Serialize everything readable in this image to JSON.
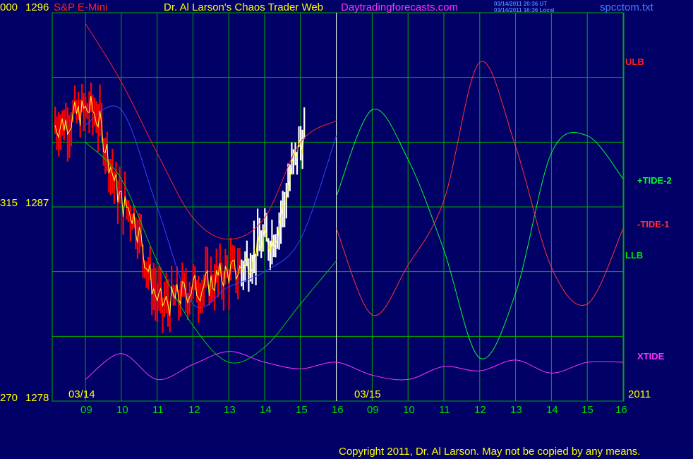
{
  "header": {
    "left_code": "000",
    "left_price": "1296",
    "symbol": "S&P E-Mini",
    "title": "Dr. Al Larson's Chaos Trader Web",
    "site": "Daytradingforecasts.com",
    "time_ut": "03/14/2011 20:36 UT",
    "time_local": "03/14/2011 16:36 Local",
    "file": "spcctom.txt"
  },
  "y_axis": {
    "mid_code": "315",
    "mid_price": "1287",
    "bottom_code": "270",
    "bottom_price": "1278"
  },
  "x_axis": {
    "hours": [
      "09",
      "10",
      "11",
      "12",
      "13",
      "14",
      "15",
      "16",
      "09",
      "10",
      "11",
      "12",
      "13",
      "14",
      "15",
      "16"
    ],
    "date_left": "03/14",
    "date_mid": "03/15",
    "year": "2011"
  },
  "legend": {
    "ulb": "ULB",
    "tide2": "+TIDE-2",
    "tide1": "-TIDE-1",
    "llb": "LLB",
    "xtide": "XTIDE"
  },
  "footer": {
    "copyright": "Copyright 2011, Dr. Al Larson. May not be copied by any means."
  },
  "colors": {
    "background": "#000066",
    "grid": "#00aa00",
    "ulb": "#ff2020",
    "llb": "#00cc00",
    "tide2": "#00ff33",
    "tide1": "#ff3333",
    "xtide": "#ff33ff",
    "price_fast": "#ffff33",
    "price_slow": "#3344ff",
    "bars_history": "#ff0000",
    "bars_today": "#ffffff"
  },
  "chart_data": {
    "type": "line",
    "title": "S&P E-Mini",
    "xlabel": "",
    "ylabel": "",
    "ylim": [
      1278,
      1296
    ],
    "x": [
      "03/14 09:00",
      "03/14 10:00",
      "03/14 11:00",
      "03/14 12:00",
      "03/14 13:00",
      "03/14 14:00",
      "03/14 15:00",
      "03/14 16:00",
      "03/15 09:00",
      "03/15 10:00",
      "03/15 11:00",
      "03/15 12:00",
      "03/15 13:00",
      "03/15 14:00",
      "03/15 15:00",
      "03/15 16:00"
    ],
    "series": [
      {
        "name": "ULB",
        "values": [
          1295.5,
          1292.8,
          1289.5,
          1286.5,
          1285.5,
          1286.5,
          1290.0,
          1291.0,
          null,
          null,
          null,
          null,
          null,
          null,
          null,
          null
        ]
      },
      {
        "name": "LLB",
        "values": [
          1290.0,
          1288.3,
          1284.5,
          1281.5,
          1279.8,
          1280.5,
          1282.5,
          1284.5,
          null,
          null,
          null,
          null,
          null,
          null,
          null,
          null
        ]
      },
      {
        "name": "+TIDE-2",
        "values": [
          null,
          null,
          null,
          null,
          null,
          null,
          null,
          1287.5,
          1291.5,
          1289.2,
          1285.0,
          1280.0,
          1283.0,
          1289.5,
          1290.3,
          1288.3
        ]
      },
      {
        "name": "-TIDE-1",
        "values": [
          null,
          null,
          null,
          null,
          null,
          null,
          null,
          1286.0,
          1282.0,
          1284.3,
          1287.3,
          1293.7,
          1289.8,
          1284.2,
          1282.5,
          1286.0
        ]
      },
      {
        "name": "XTIDE",
        "values": [
          1279.0,
          1280.2,
          1279.0,
          1279.7,
          1280.3,
          1279.8,
          1279.5,
          1279.8,
          1279.2,
          1279.0,
          1279.6,
          1279.4,
          1279.9,
          1279.3,
          1279.8,
          1279.8
        ]
      },
      {
        "name": "S&P E-Mini",
        "values": [
          1290.8,
          1291.5,
          1287.0,
          1282.5,
          1283.3,
          1284.0,
          1285.5,
          1290.3,
          null,
          null,
          null,
          null,
          null,
          null,
          null,
          null
        ]
      }
    ],
    "grid": true
  }
}
